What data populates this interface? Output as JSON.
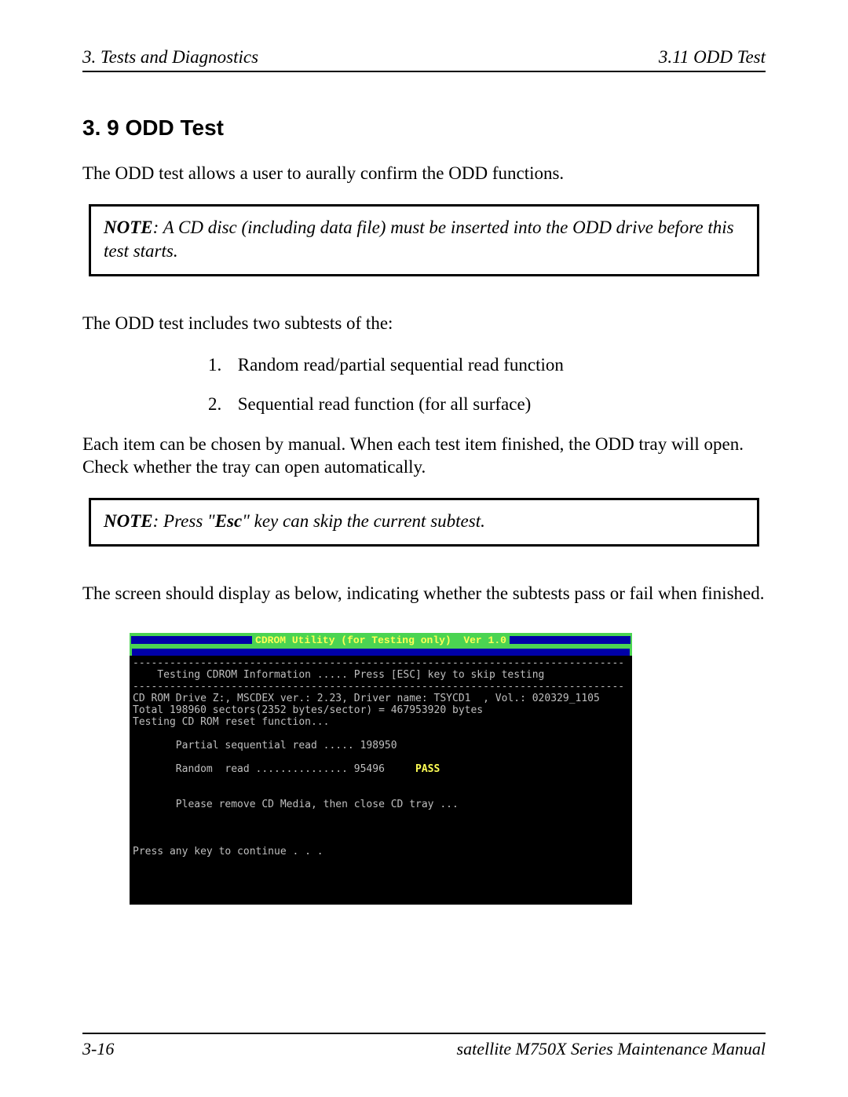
{
  "header": {
    "left": "3.  Tests and Diagnostics",
    "right": "3.11  ODD Test"
  },
  "section_title": "3. 9 ODD Test",
  "intro": "The ODD test allows a user to aurally confirm the ODD functions.",
  "note1": {
    "label": "NOTE",
    "text": ":  A CD disc (including data file) must be inserted into the ODD drive before this test starts."
  },
  "subtests_intro": "The ODD test includes two subtests of the:",
  "subtests": [
    "Random read/partial sequential read function",
    "Sequential read function (for all surface)"
  ],
  "tray_text": "Each item can be chosen by manual. When each test item finished, the ODD tray will open. Check whether the tray can open automatically.",
  "note2": {
    "label": "NOTE",
    "prefix": ":  Press \"",
    "kw": "Esc",
    "suffix": "\" key can skip the current subtest."
  },
  "screen_intro": "The screen should display as below, indicating whether the subtests pass or fail when finished.",
  "dos": {
    "title": "CDROM Utility (for Testing only)  Ver 1.0",
    "divider": "--------------------------------------------------------------------------------",
    "line_info": "    Testing CDROM Information ..... Press [ESC] key to skip testing",
    "line_drive": "CD ROM Drive Z:, MSCDEX ver.: 2.23, Driver name: TSYCD1  , Vol.: 020329_1105",
    "line_total": "Total 198960 sectors(2352 bytes/sector) = 467953920 bytes",
    "line_reset": "Testing CD ROM reset function...",
    "line_partial": "       Partial sequential read ..... 198950",
    "line_random_pre": "       Random  read ............... 95496     ",
    "pass": "PASS",
    "line_remove": "       Please remove CD Media, then close CD tray ...",
    "line_continue": "Press any key to continue . . ."
  },
  "footer": {
    "left": "3-16",
    "right": "satellite M750X Series Maintenance Manual"
  }
}
